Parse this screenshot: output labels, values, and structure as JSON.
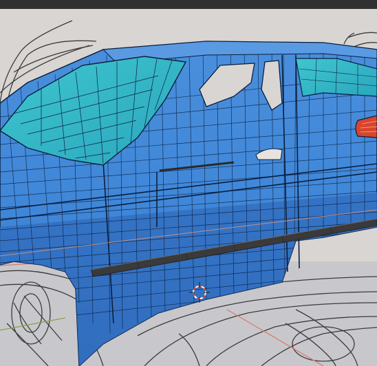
{
  "viewport": {
    "mode": "edit",
    "object": "car body mesh",
    "colors": {
      "header": "#303030",
      "background": "#d9d5d2",
      "mesh_face": "#3f86d8",
      "mesh_face_dark": "#2f6fbd",
      "mesh_wire": "#0b1e3c",
      "selected_faces": "#32b8c8",
      "trim_strip": "#3a3a3a",
      "sketch_lines": "#3b3b3b",
      "tail_light": "#d8452b",
      "axis_x": "#d8786a",
      "axis_y": "#83a34a"
    },
    "icons": [
      "3d-cursor-icon"
    ]
  }
}
